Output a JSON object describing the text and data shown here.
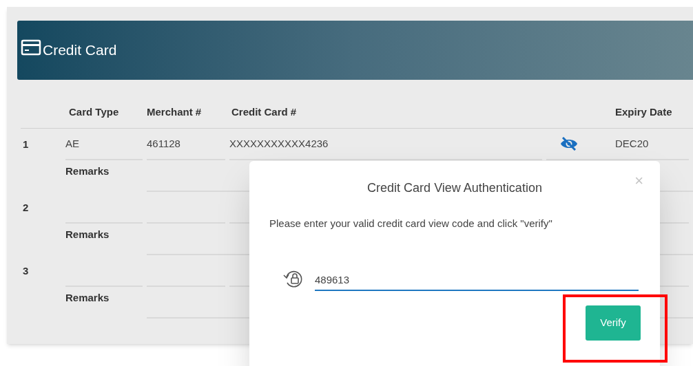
{
  "panel": {
    "title": "Credit Card"
  },
  "table": {
    "columns": [
      "Card Type",
      "Merchant #",
      "Credit Card #",
      "Expiry Date"
    ],
    "rows": [
      {
        "number": "1",
        "card_type": "AE",
        "merchant": "461128",
        "credit_card": "XXXXXXXXXXX4236",
        "expiry": "DEC20",
        "remarks_label": "Remarks"
      },
      {
        "number": "2",
        "remarks_label": "Remarks"
      },
      {
        "number": "3",
        "remarks_label": "Remarks"
      }
    ]
  },
  "dialog": {
    "title": "Credit Card View Authentication",
    "close": "×",
    "message": "Please enter your valid credit card view code and click \"verify\"",
    "code_field": {
      "value": "489613"
    },
    "button": "Verify",
    "highlighted": true
  }
}
